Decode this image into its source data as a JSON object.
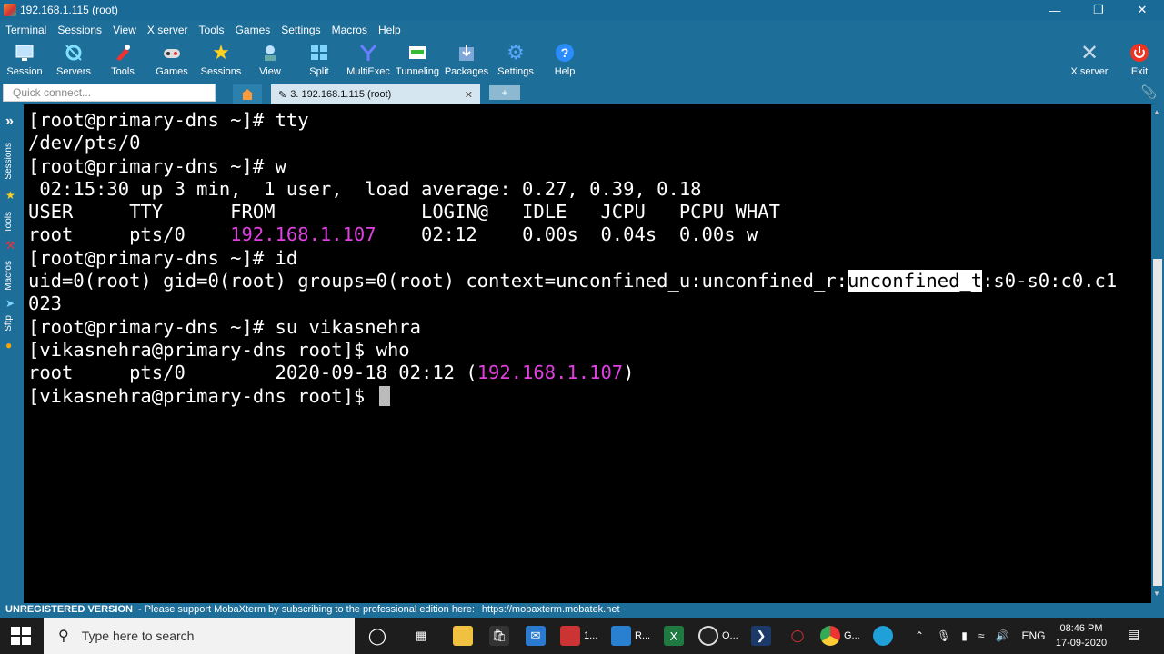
{
  "window": {
    "title": "192.168.1.115 (root)"
  },
  "menu": [
    "Terminal",
    "Sessions",
    "View",
    "X server",
    "Tools",
    "Games",
    "Settings",
    "Macros",
    "Help"
  ],
  "toolbar": {
    "items": [
      "Session",
      "Servers",
      "Tools",
      "Games",
      "Sessions",
      "View",
      "Split",
      "MultiExec",
      "Tunneling",
      "Packages",
      "Settings",
      "Help"
    ],
    "right": [
      "X server",
      "Exit"
    ]
  },
  "tabs": {
    "quick_connect_placeholder": "Quick connect...",
    "session_tab": "3. 192.168.1.115 (root)",
    "add_tab": "+"
  },
  "sidebar": {
    "labels": [
      "Sessions",
      "Tools",
      "Macros",
      "Sftp"
    ]
  },
  "terminal": {
    "l1": "[root@primary-dns ~]# tty",
    "l2": "/dev/pts/0",
    "l3": "[root@primary-dns ~]# w",
    "l4": " 02:15:30 up 3 min,  1 user,  load average: 0.27, 0.39, 0.18",
    "l5": "USER     TTY      FROM             LOGIN@   IDLE   JCPU   PCPU WHAT",
    "l6a": "root     pts/0    ",
    "l6ip": "192.168.1.107",
    "l6b": "    02:12    0.00s  0.04s  0.00s w",
    "l7": "[root@primary-dns ~]# id",
    "l8a": "uid=0(root) gid=0(root) groups=0(root) context=unconfined_u:unconfined_r:",
    "l8sel": "unconfined_t",
    "l8b": ":s0-s0:c0.c1",
    "l9": "023",
    "l10": "[root@primary-dns ~]# su vikasnehra",
    "l11": "[vikasnehra@primary-dns root]$ who",
    "l12a": "root     pts/0        2020-09-18 02:12 (",
    "l12ip": "192.168.1.107",
    "l12b": ")",
    "l13": "[vikasnehra@primary-dns root]$ "
  },
  "status": {
    "label": "UNREGISTERED VERSION",
    "message": "-  Please support MobaXterm by subscribing to the professional edition here:",
    "link": "https://mobaxterm.mobatek.net"
  },
  "taskbar": {
    "search_placeholder": "Type here to search",
    "items": [
      "1...",
      "R...",
      "O...",
      "G..."
    ],
    "lang": "ENG",
    "time": "08:46 PM",
    "date": "17-09-2020"
  },
  "colors": {
    "chrome": "#1e6e9a",
    "ip": "#e040e0",
    "terminal_bg": "#000000"
  }
}
